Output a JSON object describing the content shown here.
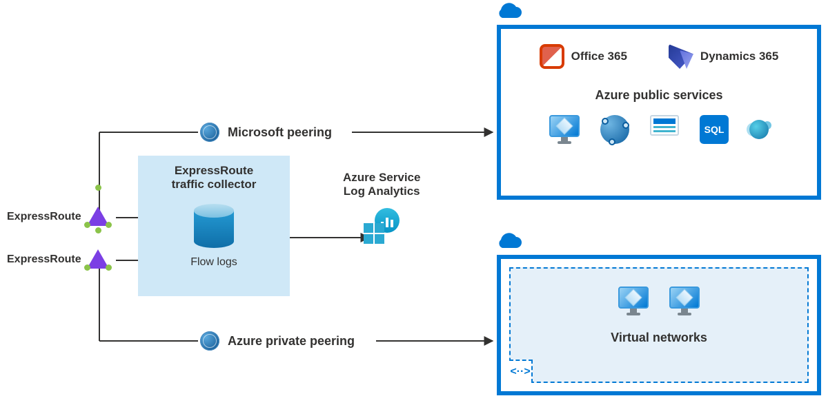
{
  "labels": {
    "er1": "ExpressRoute",
    "er2": "ExpressRoute",
    "ms_peering": "Microsoft peering",
    "azure_private_peering": "Azure private peering",
    "traffic_collector_title": "ExpressRoute\ntraffic collector",
    "flow_logs": "Flow logs",
    "log_analytics": "Azure Service\nLog Analytics",
    "office_365": "Office 365",
    "dynamics_365": "Dynamics 365",
    "public_services": "Azure public services",
    "virtual_networks": "Virtual networks",
    "vnet_tag": "<··>"
  },
  "colors": {
    "azure_blue": "#0078d4",
    "panel_bg": "#ffffff",
    "tc_bg": "#cfe8f7"
  },
  "chart_data": {
    "type": "network-diagram",
    "nodes": [
      {
        "id": "er1",
        "label": "ExpressRoute"
      },
      {
        "id": "er2",
        "label": "ExpressRoute"
      },
      {
        "id": "tc",
        "label": "ExpressRoute traffic collector",
        "sub": "Flow logs"
      },
      {
        "id": "la",
        "label": "Azure Service Log Analytics"
      },
      {
        "id": "ms_peering",
        "label": "Microsoft peering"
      },
      {
        "id": "priv_peering",
        "label": "Azure private peering"
      },
      {
        "id": "cloud_public",
        "label": "Azure public services",
        "contains": [
          "Office 365",
          "Dynamics 365",
          "Monitor",
          "App Service nodes",
          "Web App",
          "SQL",
          "Cosmos DB"
        ]
      },
      {
        "id": "cloud_vnet",
        "label": "Virtual networks",
        "contains": [
          "VM",
          "VM"
        ]
      }
    ],
    "edges": [
      {
        "from": "er1",
        "to": "tc"
      },
      {
        "from": "er2",
        "to": "tc"
      },
      {
        "from": "tc",
        "to": "la"
      },
      {
        "from": "er-junction",
        "to": "ms_peering"
      },
      {
        "from": "ms_peering",
        "to": "cloud_public"
      },
      {
        "from": "er-junction",
        "to": "priv_peering"
      },
      {
        "from": "priv_peering",
        "to": "cloud_vnet"
      }
    ]
  }
}
